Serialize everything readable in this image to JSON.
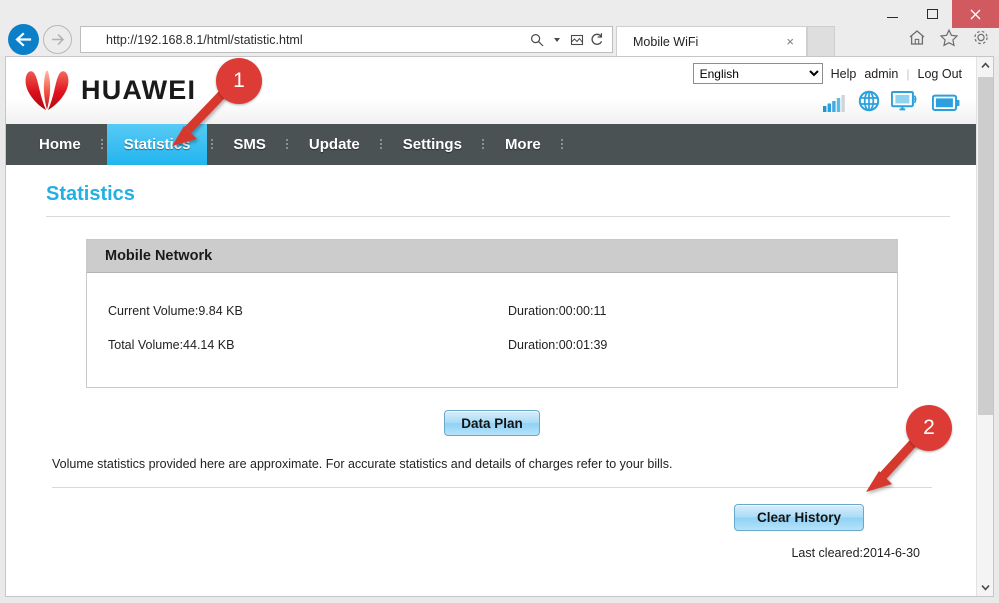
{
  "browser": {
    "url": "http://192.168.8.1/html/statistic.html",
    "tab_title": "Mobile WiFi",
    "tab_close_label": "×",
    "back_icon": "back-arrow-icon",
    "forward_icon": "forward-arrow-icon",
    "search_icon": "search-icon",
    "compat_icon": "compatibility-view-icon",
    "refresh_icon": "refresh-icon",
    "home_icon": "home-icon",
    "favorites_icon": "star-icon",
    "tools_icon": "gear-icon",
    "minimize_label": "–",
    "maximize_label": "□",
    "close_label": "×"
  },
  "header": {
    "brand": "HUAWEI",
    "language": "English",
    "language_options": [
      "English"
    ],
    "help_label": "Help",
    "user_label": "admin",
    "logout_label": "Log Out",
    "status_icons": [
      "signal-bars-icon",
      "globe-icon",
      "monitor-wifi-icon",
      "battery-icon"
    ],
    "signal_bars_filled": 4,
    "signal_bars_total": 5
  },
  "nav": {
    "items": [
      {
        "label": "Home",
        "active": false
      },
      {
        "label": "Statistics",
        "active": true
      },
      {
        "label": "SMS",
        "active": false
      },
      {
        "label": "Update",
        "active": false
      },
      {
        "label": "Settings",
        "active": false
      },
      {
        "label": "More",
        "active": false
      }
    ]
  },
  "main": {
    "page_title": "Statistics",
    "panel_title": "Mobile Network",
    "rows": [
      {
        "left": "Current Volume:9.84 KB",
        "right": "Duration:00:00:11"
      },
      {
        "left": "Total Volume:44.14 KB",
        "right": "Duration:00:01:39"
      }
    ],
    "data_plan_button": "Data Plan",
    "disclaimer": "Volume statistics provided here are approximate. For accurate statistics and details of charges refer to your bills.",
    "clear_history_button": "Clear History",
    "last_cleared": "Last cleared:2014-6-30"
  },
  "annotations": [
    {
      "number": "1",
      "target": "statistics-nav-tab"
    },
    {
      "number": "2",
      "target": "clear-history-button"
    }
  ],
  "colors": {
    "accent_cyan": "#22b0e2",
    "nav_bar": "#4a5254",
    "active_tab": "#29bdf2",
    "brand_red": "#e00b1e",
    "annotation_red": "#dd3b36",
    "panel_header_gray": "#cccccc"
  }
}
